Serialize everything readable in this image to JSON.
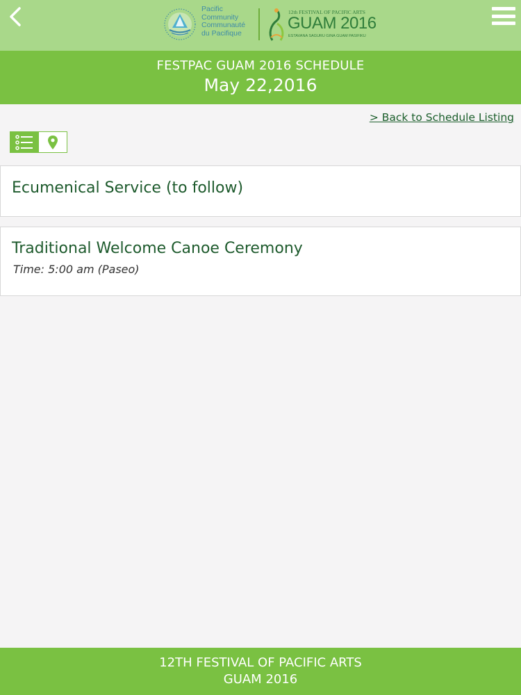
{
  "topbar": {
    "back_icon": "chevron-left-icon",
    "menu_icon": "hamburger-menu-icon",
    "spc_logo": {
      "line1": "Pacific",
      "line2": "Community",
      "line3": "Communauté",
      "line4": "du Pacifique"
    },
    "festival_logo": {
      "small": "12th FESTIVAL OF PACIFIC ARTS",
      "big": "GUAM 2016",
      "tagline": "ESTAVANA SAGURU GINA GUAM PASIFIKU"
    },
    "bar_color": "#a9d88a"
  },
  "header": {
    "title": "FESTPAC GUAM 2016 SCHEDULE",
    "date": "May 22,2016",
    "color": "#7ac142"
  },
  "back_link": "> Back to Schedule Listing",
  "view_toggle": {
    "list_icon": "list-view-icon",
    "map_icon": "map-pin-icon",
    "active": "list"
  },
  "events": [
    {
      "title": "Ecumenical Service (to follow)"
    },
    {
      "title": "Traditional Welcome Canoe Ceremony",
      "time": "Time: 5:00 am (Paseo)"
    }
  ],
  "footer": {
    "line1": "12TH FESTIVAL OF PACIFIC ARTS",
    "line2": "GUAM 2016"
  }
}
